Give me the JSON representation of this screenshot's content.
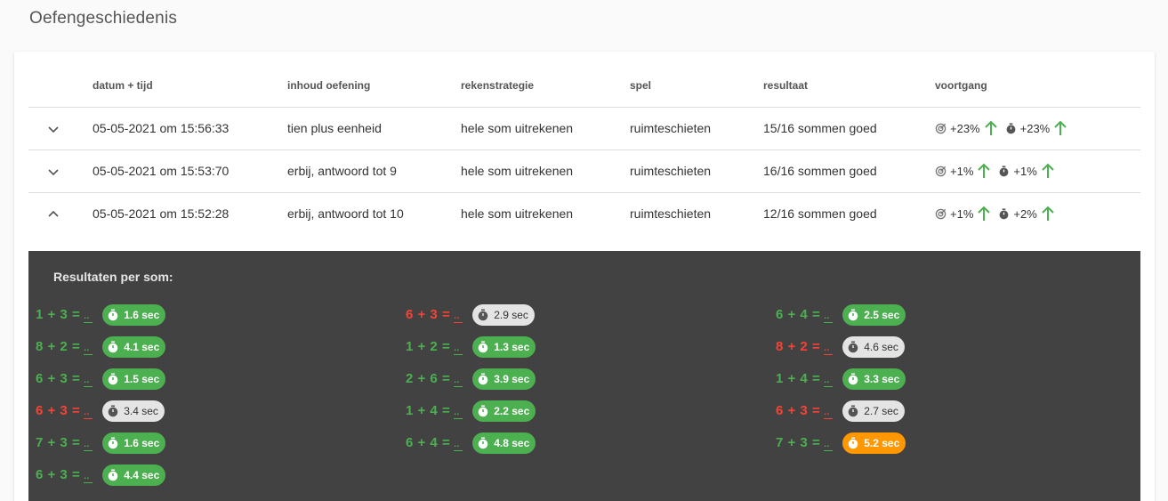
{
  "page": {
    "title": "Oefengeschiedenis"
  },
  "table": {
    "headers": [
      "datum + tijd",
      "inhoud oefening",
      "rekenstrategie",
      "spel",
      "resultaat",
      "voortgang"
    ],
    "rows": [
      {
        "datetime": "05-05-2021 om 15:56:33",
        "content": "tien plus eenheid",
        "strategy": "hele som uitrekenen",
        "game": "ruimteschieten",
        "result": "15/16 sommen goed",
        "progress_accuracy": "+23%",
        "progress_time": "+23%",
        "expanded": false
      },
      {
        "datetime": "05-05-2021 om 15:53:70",
        "content": "erbij, antwoord tot 9",
        "strategy": "hele som uitrekenen",
        "game": "ruimteschieten",
        "result": "16/16 sommen goed",
        "progress_accuracy": "+1%",
        "progress_time": "+1%",
        "expanded": false
      },
      {
        "datetime": "05-05-2021 om 15:52:28",
        "content": "erbij, antwoord tot 10",
        "strategy": "hele som uitrekenen",
        "game": "ruimteschieten",
        "result": "12/16 sommen goed",
        "progress_accuracy": "+1%",
        "progress_time": "+2%",
        "expanded": true
      }
    ]
  },
  "details": {
    "title": "Resultaten per som:",
    "blank_label": "..",
    "columns": [
      [
        {
          "sum": "1 + 3 =",
          "correct": true,
          "time": "1.6 sec",
          "badge": "green"
        },
        {
          "sum": "8 + 2 =",
          "correct": true,
          "time": "4.1 sec",
          "badge": "green"
        },
        {
          "sum": "6 + 3 =",
          "correct": true,
          "time": "1.5 sec",
          "badge": "green"
        },
        {
          "sum": "6 + 3 =",
          "correct": false,
          "time": "3.4 sec",
          "badge": "grey"
        },
        {
          "sum": "7 + 3 =",
          "correct": true,
          "time": "1.6 sec",
          "badge": "green"
        },
        {
          "sum": "6 + 3 =",
          "correct": true,
          "time": "4.4 sec",
          "badge": "green"
        }
      ],
      [
        {
          "sum": "6 + 3 =",
          "correct": false,
          "time": "2.9 sec",
          "badge": "grey"
        },
        {
          "sum": "1 + 2 =",
          "correct": true,
          "time": "1.3 sec",
          "badge": "green"
        },
        {
          "sum": "2 + 6 =",
          "correct": true,
          "time": "3.9 sec",
          "badge": "green"
        },
        {
          "sum": "1 + 4 =",
          "correct": true,
          "time": "2.2 sec",
          "badge": "green"
        },
        {
          "sum": "6 + 4 =",
          "correct": true,
          "time": "4.8 sec",
          "badge": "green"
        }
      ],
      [
        {
          "sum": "6 + 4 =",
          "correct": true,
          "time": "2.5 sec",
          "badge": "green"
        },
        {
          "sum": "8 + 2 =",
          "correct": false,
          "time": "4.6 sec",
          "badge": "grey"
        },
        {
          "sum": "1 + 4 =",
          "correct": true,
          "time": "3.3 sec",
          "badge": "green"
        },
        {
          "sum": "6 + 3 =",
          "correct": false,
          "time": "2.7 sec",
          "badge": "grey"
        },
        {
          "sum": "7 + 3 =",
          "correct": true,
          "time": "5.2 sec",
          "badge": "orange"
        }
      ]
    ]
  },
  "colors": {
    "correct": "#4caf50",
    "wrong": "#f44336",
    "panel": "#424242",
    "badge_orange": "#ff9800",
    "arrow_up": "#4caf50"
  },
  "icons": {
    "expand": "chevron-down-icon",
    "collapse": "chevron-up-icon",
    "accuracy": "target-icon",
    "time": "stopwatch-icon",
    "progress_up": "arrow-up-icon"
  }
}
